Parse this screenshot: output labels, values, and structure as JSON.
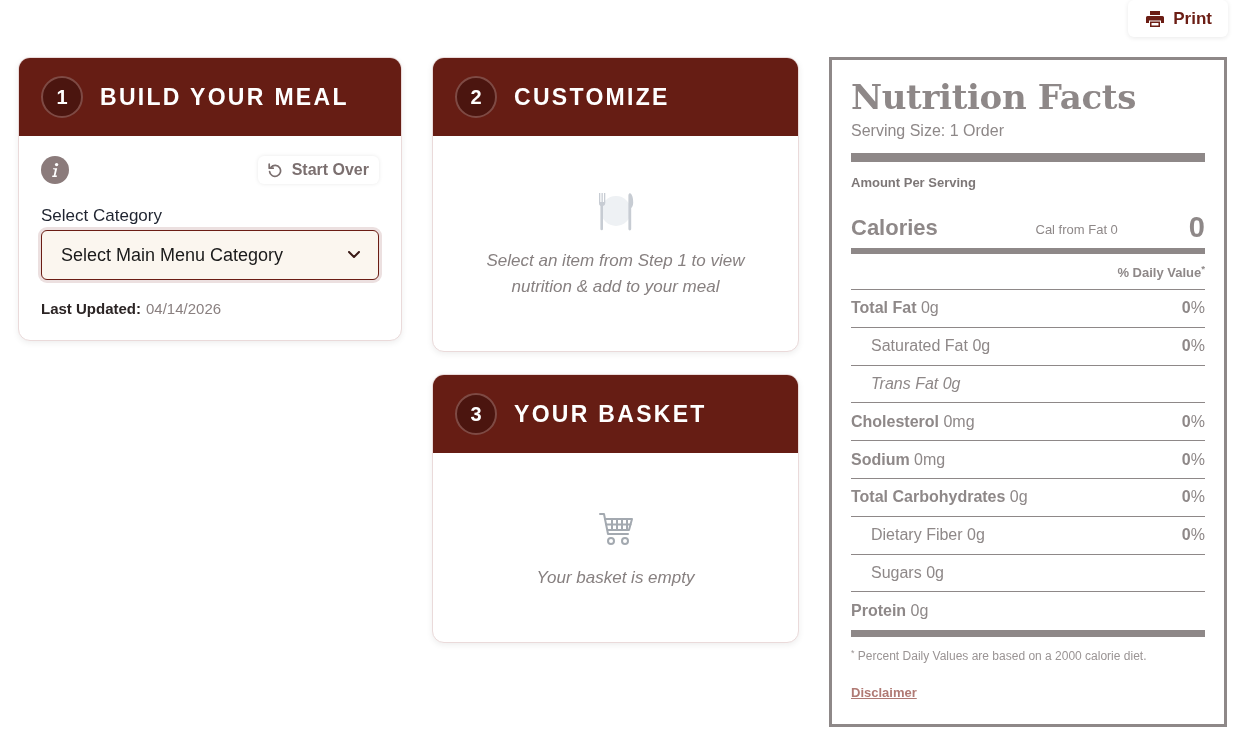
{
  "print_button": {
    "label": "Print"
  },
  "steps": [
    {
      "kind": "build",
      "number": "1",
      "title": "BUILD YOUR MEAL",
      "start_over": "Start Over",
      "category_label": "Select Category",
      "category_select": {
        "value": "Select Main Menu Category"
      },
      "last_updated": {
        "label": "Last Updated:",
        "value": "04/14/2026"
      }
    },
    {
      "kind": "customize",
      "number": "2",
      "title": "CUSTOMIZE",
      "message": "Select an item from Step 1 to view nutrition & add to your meal"
    },
    {
      "kind": "basket",
      "number": "3",
      "title": "YOUR BASKET",
      "message": "Your basket is empty"
    }
  ],
  "nutrition_facts": {
    "title": "Nutrition Facts",
    "serving_size": "Serving Size: 1 Order",
    "amount_per_serving": "Amount Per Serving",
    "calories_label": "Calories",
    "cal_from_fat": "Cal from Fat 0",
    "calories": "0",
    "daily_value_header": "% Daily Value$^{*}$",
    "rows": [
      {
        "kind": "main",
        "label": "**Total Fat** 0g",
        "daily_value": "**0**%"
      },
      {
        "kind": "sub",
        "label": "Saturated Fat 0g",
        "daily_value": "**0**%"
      },
      {
        "kind": "italic",
        "label": "Trans Fat 0g"
      },
      {
        "kind": "main",
        "label": "**Cholesterol** 0mg",
        "daily_value": "**0**%"
      },
      {
        "kind": "main",
        "label": "**Sodium** 0mg",
        "daily_value": "**0**%"
      },
      {
        "kind": "main",
        "label": "**Total Carbohydrates** 0g",
        "daily_value": "**0**%"
      },
      {
        "kind": "sub",
        "label": "Dietary Fiber 0g",
        "daily_value": "**0**%"
      },
      {
        "kind": "sub",
        "label": "Sugars 0g"
      },
      {
        "kind": "main",
        "label": "**Protein** 0g"
      }
    ],
    "footnote": "$^{*}$ Percent Daily Values are based on a 2000 calorie diet.",
    "disclaimer": "Disclaimer"
  }
}
